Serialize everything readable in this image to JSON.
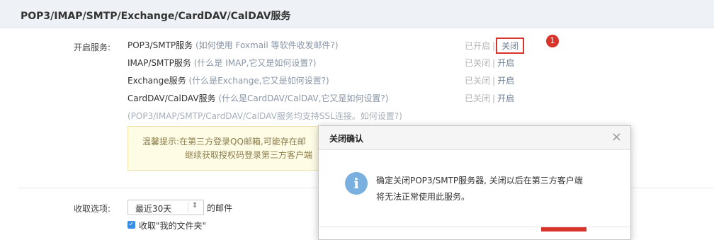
{
  "section": {
    "title": "POP3/IMAP/SMTP/Exchange/CardDAV/CalDAV服务"
  },
  "services": {
    "label": "开启服务:",
    "rows": [
      {
        "name": "POP3/SMTP服务",
        "hint": "(如何使用 Foxmail 等软件收发邮件?)",
        "status": "已开启",
        "action": "关闭"
      },
      {
        "name": "IMAP/SMTP服务",
        "hint": "(什么是 IMAP,它又是如何设置?)",
        "status": "已关闭",
        "action": "开启"
      },
      {
        "name": "Exchange服务",
        "hint": "(什么是Exchange,它又是如何设置?)",
        "status": "已关闭",
        "action": "开启"
      },
      {
        "name": "CardDAV/CalDAV服务",
        "hint": "(什么是CardDAV/CalDAV,它又是如何设置?)",
        "status": "已关闭",
        "action": "开启"
      }
    ],
    "separator": "|",
    "ssl_note": "(POP3/IMAP/SMTP/CardDAV/CalDAV服务均支持SSL连接。如何设置?)"
  },
  "annotation": {
    "badge": "1"
  },
  "tip": {
    "line1": "温馨提示:在第三方登录QQ邮箱,可能存在邮",
    "line2": "继续获取授权码登录第三方客户端"
  },
  "receive": {
    "label": "收取选项:",
    "select_value": "最近30天",
    "select_arrow": "⇕",
    "suffix": "的邮件",
    "checkbox_label": "收取\"我的文件夹\""
  },
  "modal": {
    "title": "关闭确认",
    "close_glyph": "×",
    "icon_glyph": "i",
    "message_line1": "确定关闭POP3/SMTP服务器, 关闭以后在第三方客户端",
    "message_line2": "将无法正常使用此服务。"
  },
  "colors": {
    "accent_red": "#d9342b",
    "info_blue": "#7ab0e0",
    "link": "#6f7f93"
  }
}
